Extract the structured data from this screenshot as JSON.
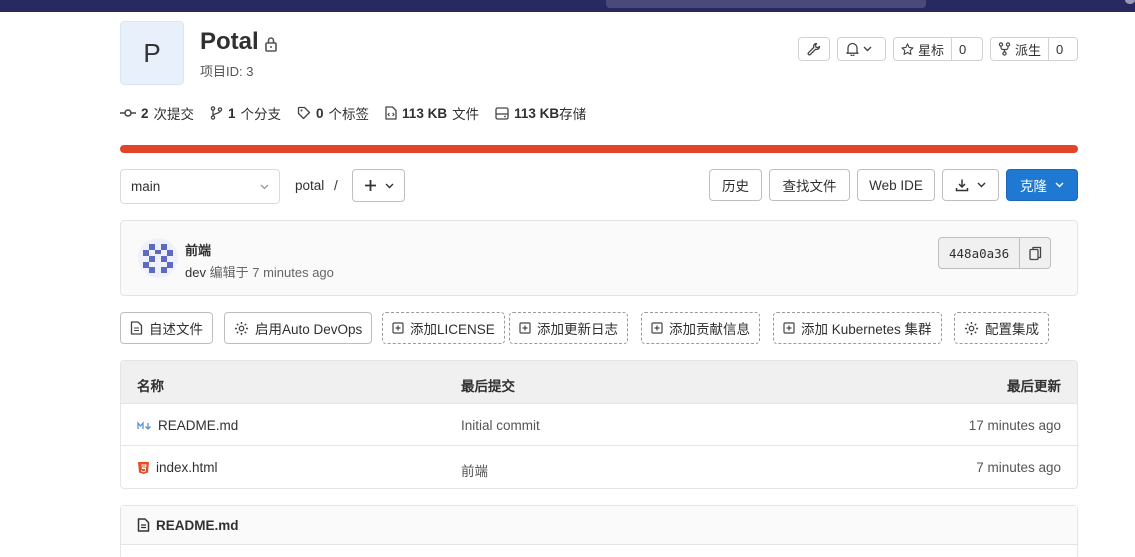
{
  "project": {
    "avatar_letter": "P",
    "name": "Potal",
    "id_label": "项目ID: 3"
  },
  "header_actions": {
    "star_label": "星标",
    "star_count": "0",
    "fork_label": "派生",
    "fork_count": "0"
  },
  "stats": {
    "commits_num": "2",
    "commits_label": "次提交",
    "branches_num": "1",
    "branches_label": "个分支",
    "tags_num": "0",
    "tags_label": "个标签",
    "files_num": "113 KB",
    "files_label": "文件",
    "storage_num": "113 KB",
    "storage_label": "存储"
  },
  "repo_nav": {
    "branch": "main",
    "path": "potal",
    "path_sep": "/",
    "history": "历史",
    "find_file": "查找文件",
    "web_ide": "Web IDE",
    "clone": "克隆"
  },
  "last_commit": {
    "title": "前端",
    "author": "dev",
    "edited_label": "编辑于",
    "time": "7 minutes ago",
    "sha": "448a0a36"
  },
  "quick_actions": [
    {
      "label": "自述文件"
    },
    {
      "label": "启用Auto DevOps"
    },
    {
      "label": "添加LICENSE"
    },
    {
      "label": "添加更新日志"
    },
    {
      "label": "添加贡献信息"
    },
    {
      "label": "添加 Kubernetes 集群"
    },
    {
      "label": "配置集成"
    }
  ],
  "file_table": {
    "headers": {
      "name": "名称",
      "last_commit": "最后提交",
      "last_update": "最后更新"
    },
    "rows": [
      {
        "name": "README.md",
        "icon": "markdown-icon",
        "commit": "Initial commit",
        "updated": "17 minutes ago"
      },
      {
        "name": "index.html",
        "icon": "html5-icon",
        "commit": "前端",
        "updated": "7 minutes ago"
      }
    ]
  },
  "readme": {
    "title": "README.md"
  },
  "colors": {
    "topbar": "#292961",
    "progress": "#e24329",
    "primary": "#1f78d1"
  }
}
